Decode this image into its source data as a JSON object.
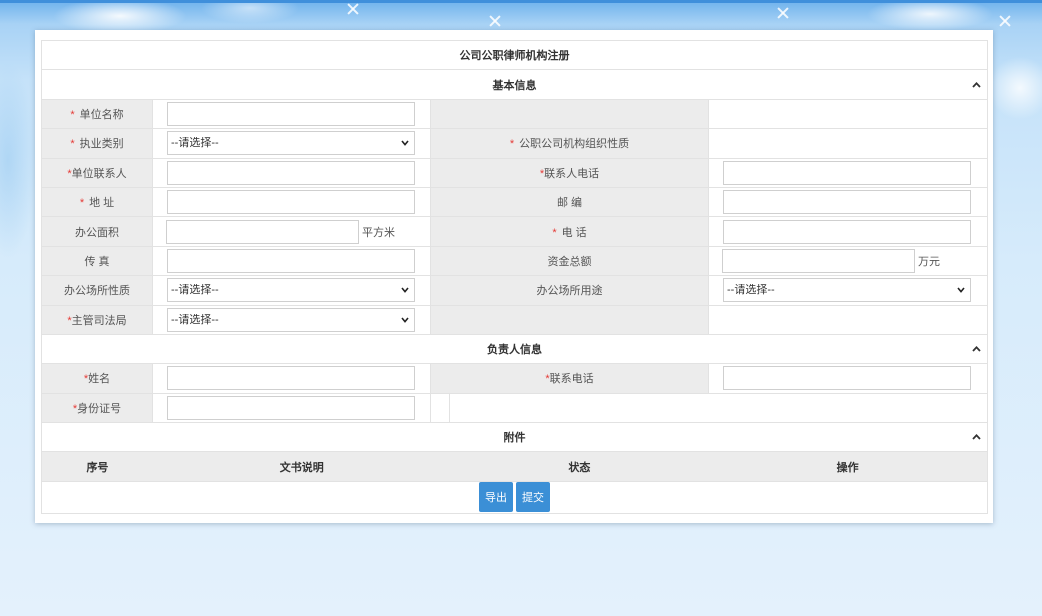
{
  "form_title": "公司公职律师机构注册",
  "basic_info": {
    "section_title": "基本信息",
    "fields": {
      "unit_name": {
        "required": "*",
        "label": "单位名称"
      },
      "practice_type": {
        "required": "*",
        "label": "执业类别",
        "selected": "--请选择--"
      },
      "org_nature": {
        "required": "*",
        "label": "公职公司机构组织性质"
      },
      "unit_contact": {
        "required": "*",
        "label": "单位联系人"
      },
      "contact_phone": {
        "required": "*",
        "label": "联系人电话"
      },
      "address": {
        "required": "*",
        "label": "地 址"
      },
      "postcode": {
        "label": "邮 编"
      },
      "office_area": {
        "label": "办公面积",
        "unit": "平方米"
      },
      "telephone": {
        "required": "*",
        "label": "电 话"
      },
      "fax": {
        "label": "传 真"
      },
      "total_funds": {
        "label": "资金总额",
        "unit": "万元"
      },
      "office_nature": {
        "label": "办公场所性质",
        "selected": "--请选择--"
      },
      "office_use": {
        "label": "办公场所用途",
        "selected": "--请选择--"
      },
      "judicial_bureau": {
        "required": "*",
        "label": "主管司法局",
        "selected": "--请选择--"
      }
    }
  },
  "leader_info": {
    "section_title": "负责人信息",
    "fields": {
      "name": {
        "required": "*",
        "label": "姓名"
      },
      "phone": {
        "required": "*",
        "label": "联系电话"
      },
      "id_number": {
        "required": "*",
        "label": "身份证号"
      }
    }
  },
  "attachments": {
    "section_title": "附件",
    "columns": [
      "序号",
      "文书说明",
      "状态",
      "操作"
    ],
    "buttons": {
      "export": "导出",
      "submit": "提交"
    }
  },
  "icons": {
    "section_toggle": "chevron-up-icon",
    "select_arrow": "chevron-down-icon"
  },
  "colors": {
    "required_mark": "#e53935",
    "button": "#3b8fd6",
    "label_cell": "#ececec",
    "border": "#e2e2e2",
    "top_bar": "#3f8fdb"
  }
}
